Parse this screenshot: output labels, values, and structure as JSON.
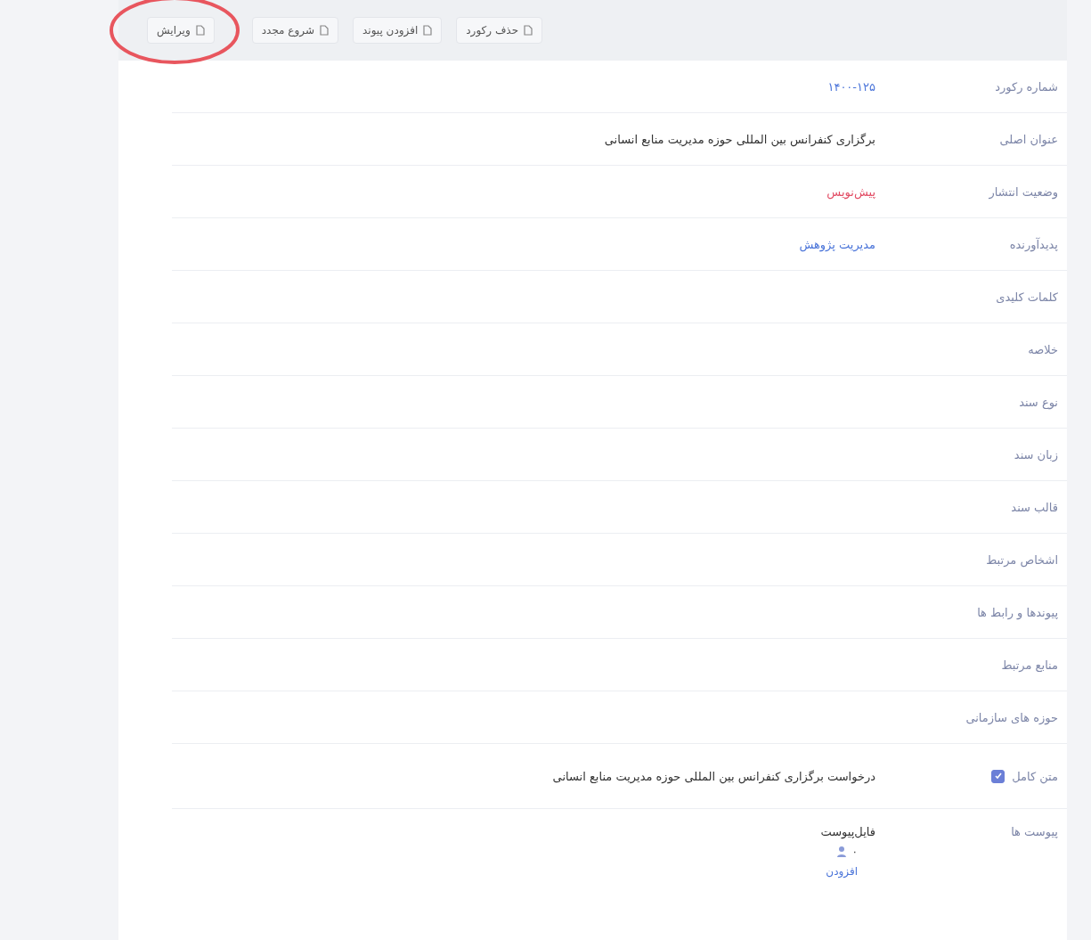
{
  "toolbar": [
    {
      "label": "حذف رکورد",
      "circled": false
    },
    {
      "label": "افزودن پیوند",
      "circled": false
    },
    {
      "label": "شروع مجدد",
      "circled": false
    },
    {
      "label": "ویرایش",
      "circled": true
    }
  ],
  "rows": [
    {
      "label": "شماره رکورد",
      "kind": "link",
      "value": "۱۴۰۰-۱۲۵"
    },
    {
      "label": "عنوان اصلی",
      "kind": "text",
      "value": "برگزاری کنفرانس بین المللی حوزه مدیریت منابع انسانی"
    },
    {
      "label": "وضعیت انتشار",
      "kind": "status",
      "value": "پیش‌نویس"
    },
    {
      "label": "پدیدآورنده",
      "kind": "link",
      "value": "مدیریت پژوهش"
    },
    {
      "label": "کلمات کلیدی",
      "kind": "empty"
    },
    {
      "label": "خلاصه",
      "kind": "empty"
    },
    {
      "label": "نوع سند",
      "kind": "empty"
    },
    {
      "label": "زبان سند",
      "kind": "empty"
    },
    {
      "label": "قالب سند",
      "kind": "empty"
    },
    {
      "label": "اشخاص مرتبط",
      "kind": "empty"
    },
    {
      "label": "پیوندها و رابط ها",
      "kind": "empty"
    },
    {
      "label": "منابع مرتبط",
      "kind": "empty"
    },
    {
      "label": "حوزه های سازمانی",
      "kind": "empty"
    },
    {
      "label": "متن کامل",
      "kind": "checkbox",
      "checked": true,
      "value": "درخواست برگزاری کنفرانس بین المللی حوزه مدیریت منابع انسانی"
    },
    {
      "label": "پیوست ها",
      "kind": "attachments",
      "file": "فایل‌پیوست",
      "count": "۰",
      "action": "افزودن"
    }
  ]
}
